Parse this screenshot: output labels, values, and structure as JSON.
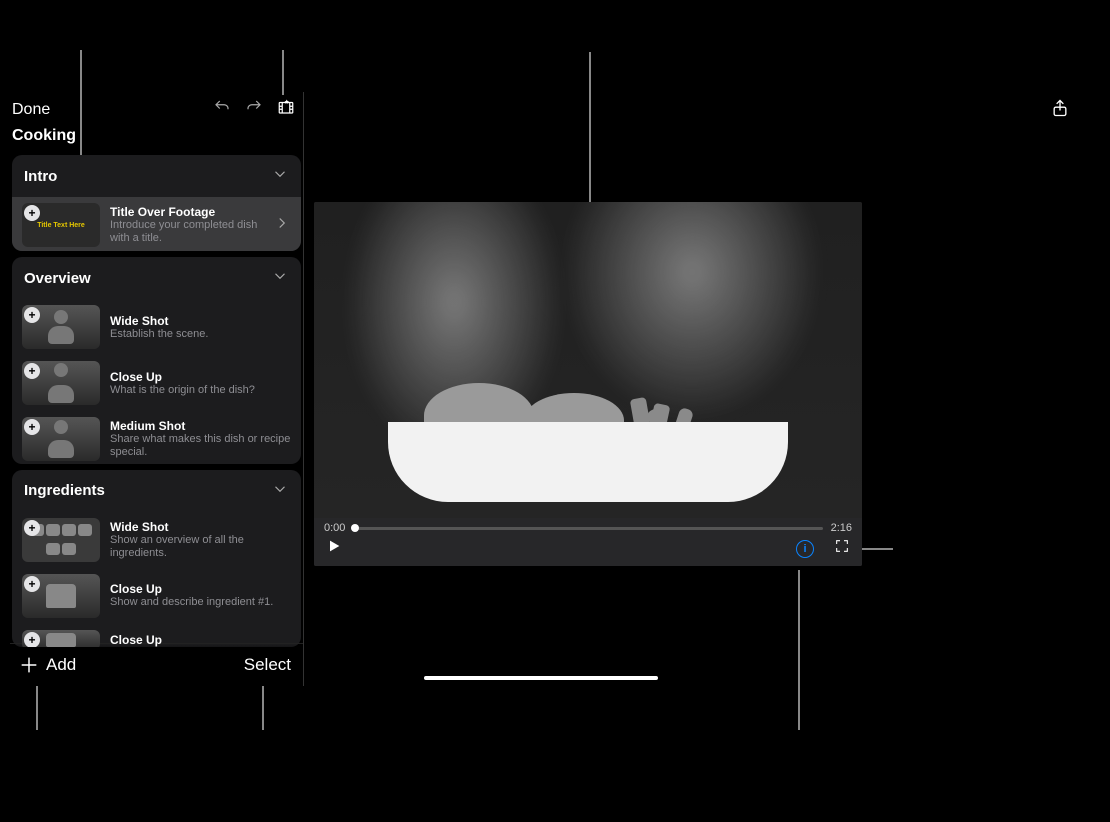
{
  "toolbar": {
    "done": "Done",
    "project_title": "Cooking"
  },
  "sections": {
    "intro": {
      "label": "Intro",
      "shots": [
        {
          "title": "Title Over Footage",
          "desc": "Introduce your completed dish with a title.",
          "thumb_text": "Title Text Here"
        }
      ]
    },
    "overview": {
      "label": "Overview",
      "shots": [
        {
          "title": "Wide Shot",
          "desc": "Establish the scene."
        },
        {
          "title": "Close Up",
          "desc": "What is the origin of the dish?"
        },
        {
          "title": "Medium Shot",
          "desc": "Share what makes this dish or recipe special."
        }
      ]
    },
    "ingredients": {
      "label": "Ingredients",
      "shots": [
        {
          "title": "Wide Shot",
          "desc": "Show an overview of all the ingredients."
        },
        {
          "title": "Close Up",
          "desc": "Show and describe ingredient #1."
        },
        {
          "title": "Close Up",
          "desc": ""
        }
      ]
    }
  },
  "footer": {
    "add": "Add",
    "select": "Select"
  },
  "player": {
    "current": "0:00",
    "duration": "2:16"
  }
}
